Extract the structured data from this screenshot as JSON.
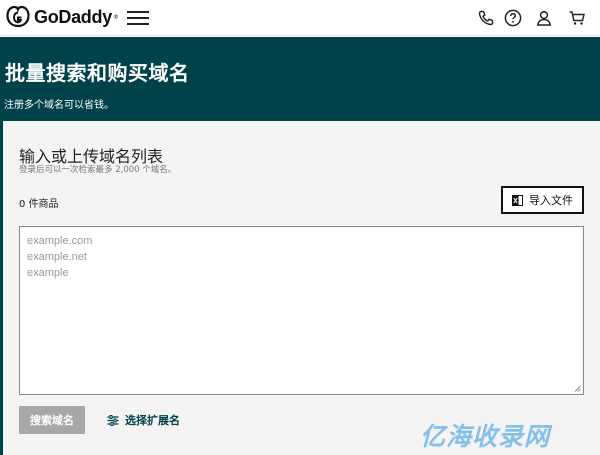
{
  "brand": {
    "name": "GoDaddy",
    "trademark": "®",
    "icon": "godaddy-logo-icon"
  },
  "header": {
    "menu_icon": "hamburger-menu-icon",
    "actions": [
      {
        "icon": "phone-icon"
      },
      {
        "icon": "help-icon"
      },
      {
        "icon": "user-icon"
      },
      {
        "icon": "cart-icon"
      }
    ]
  },
  "hero": {
    "title": "批量搜索和购买域名",
    "subtitle": "注册多个域名可以省钱。"
  },
  "card": {
    "title": "输入或上传域名列表",
    "hint": "登录后可以一次检索最多 2,000 个域名。",
    "item_count": "0 件商品",
    "import_label": "导入文件",
    "import_icon": "excel-file-icon",
    "placeholder_lines": [
      "example.com",
      "example.net",
      "example"
    ],
    "search_label": "搜索域名",
    "extensions_label": "选择扩展名",
    "extensions_icon": "sliders-icon"
  },
  "watermark": "亿海收录网",
  "colors": {
    "brand_dark": "#004249",
    "disabled_button": "#a7a7a7",
    "card_bg": "#f4f4f4"
  }
}
